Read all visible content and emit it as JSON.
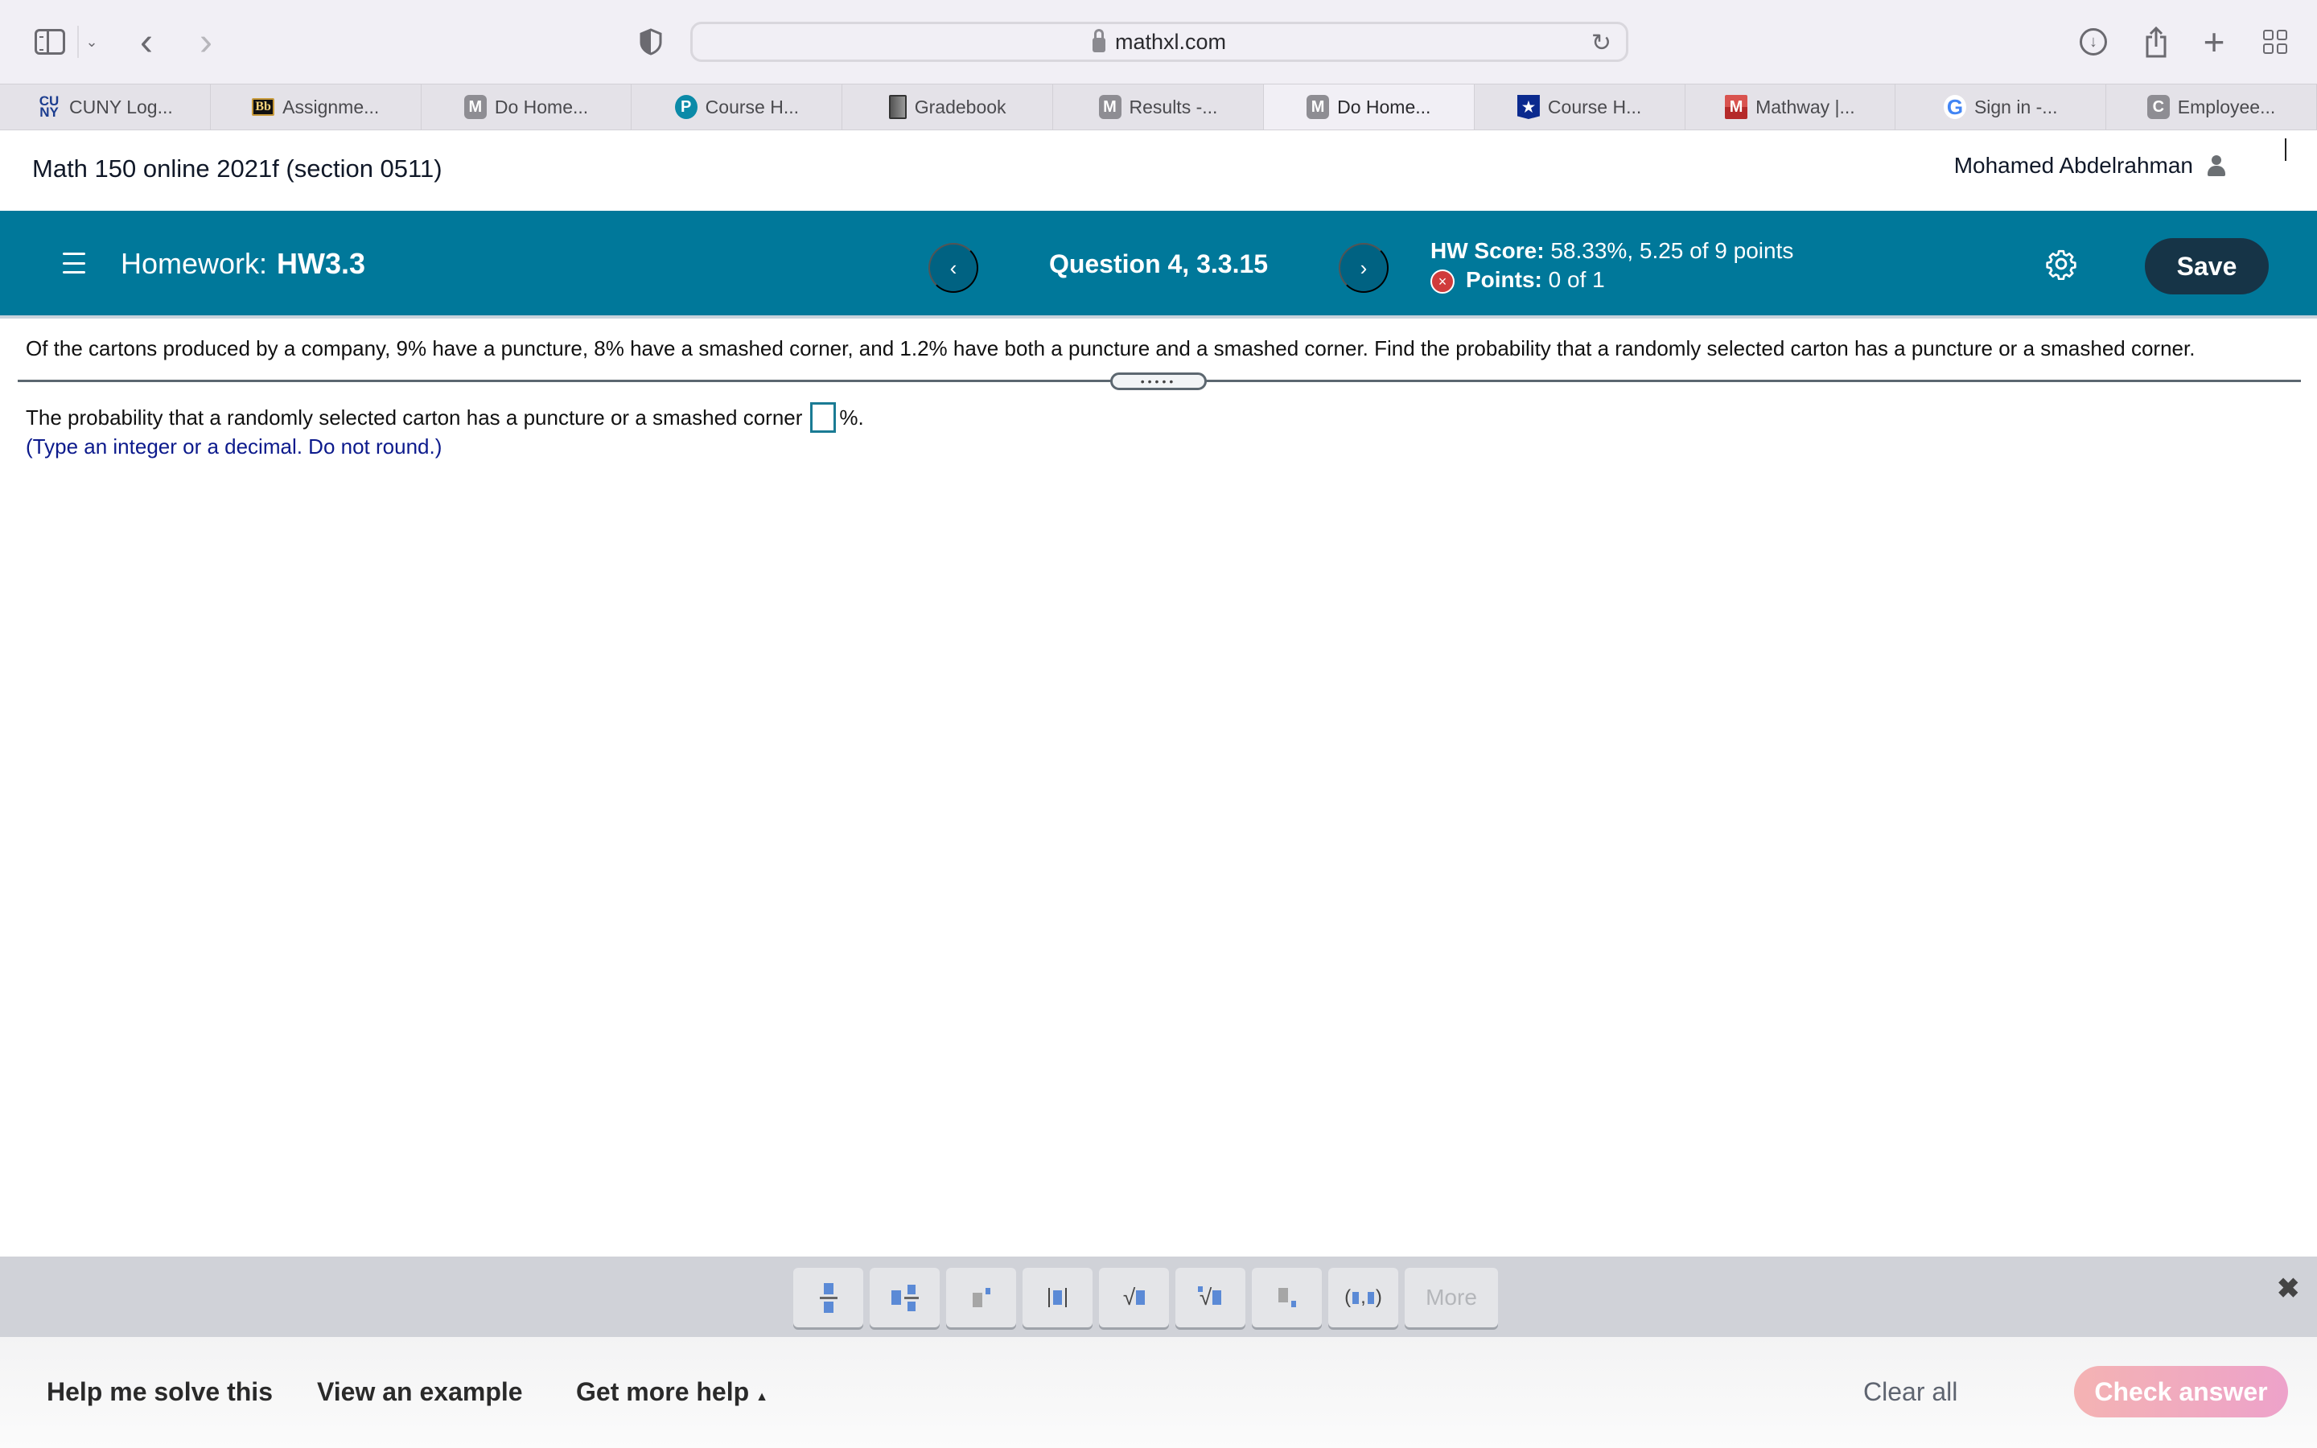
{
  "browser": {
    "url": "mathxl.com",
    "tabs": [
      {
        "label": "CUNY Log...",
        "icon": "cuny-favicon",
        "active": false
      },
      {
        "label": "Assignme...",
        "icon": "blackboard-favicon",
        "active": false
      },
      {
        "label": "Do Home...",
        "icon": "m-favicon",
        "active": false
      },
      {
        "label": "Course H...",
        "icon": "pearson-favicon",
        "active": false
      },
      {
        "label": "Gradebook",
        "icon": "gradebook-favicon",
        "active": false
      },
      {
        "label": "Results -...",
        "icon": "m-favicon",
        "active": false
      },
      {
        "label": "Do Home...",
        "icon": "m-favicon",
        "active": true
      },
      {
        "label": "Course H...",
        "icon": "star-shield-favicon",
        "active": false
      },
      {
        "label": "Mathway |...",
        "icon": "mathway-favicon",
        "active": false
      },
      {
        "label": "Sign in -...",
        "icon": "google-favicon",
        "active": false
      },
      {
        "label": "Employee...",
        "icon": "c-favicon",
        "active": false
      }
    ],
    "icons": {
      "sidebar": "sidebar-icon",
      "back": "‹",
      "forward": "›",
      "reload": "↻",
      "download": "↓",
      "share": "⇪",
      "new_tab": "+",
      "tab_overview": "grid-icon"
    }
  },
  "course": {
    "title": "Math 150 online 2021f (section 0511)",
    "user_name": "Mohamed Abdelrahman"
  },
  "homework": {
    "label": "Homework:",
    "name": "HW3.3",
    "question_label": "Question 4, 3.3.15",
    "prev_symbol": "‹",
    "next_symbol": "›",
    "hw_score_label": "HW Score:",
    "hw_score_value": "58.33%, 5.25 of 9 points",
    "points_label": "Points:",
    "points_value": "0 of 1",
    "points_status_symbol": "×",
    "settings_symbol": "⚙",
    "save_label": "Save"
  },
  "question": {
    "text": "Of the cartons produced by a company, 9% have a puncture, 8% have a smashed corner, and 1.2% have both a puncture and a smashed corner. Find the probability that a randomly selected carton has a puncture or a smashed corner.",
    "divider_handle": "•••••",
    "answer_prefix": "The probability that a randomly selected carton has a puncture or a smashed corner",
    "answer_value": "",
    "answer_suffix": "%.",
    "hint": "(Type an integer or a decimal. Do not round.)"
  },
  "palette": {
    "buttons": [
      {
        "name": "fraction",
        "tooltip": ""
      },
      {
        "name": "mixed-number",
        "tooltip": ""
      },
      {
        "name": "exponent",
        "tooltip": ""
      },
      {
        "name": "absolute-value",
        "tooltip": ""
      },
      {
        "name": "square-root",
        "tooltip": ""
      },
      {
        "name": "nth-root",
        "tooltip": ""
      },
      {
        "name": "subscript",
        "tooltip": ""
      },
      {
        "name": "ordered-pair",
        "tooltip": ""
      }
    ],
    "more_label": "More",
    "close_symbol": "✖"
  },
  "footer": {
    "help_me_solve": "Help me solve this",
    "view_example": "View an example",
    "get_more_help": "Get more help",
    "get_more_help_arrow": "▲",
    "clear_all": "Clear all",
    "check_answer": "Check answer"
  },
  "colors": {
    "header_teal": "#00789a",
    "nav_button": "#006282",
    "save_button": "#163447",
    "hint_blue": "#0c1a8c",
    "error_red": "#d03b3b",
    "check_answer_gradient_start": "#f4b3b3",
    "check_answer_gradient_end": "#eda2ca"
  }
}
